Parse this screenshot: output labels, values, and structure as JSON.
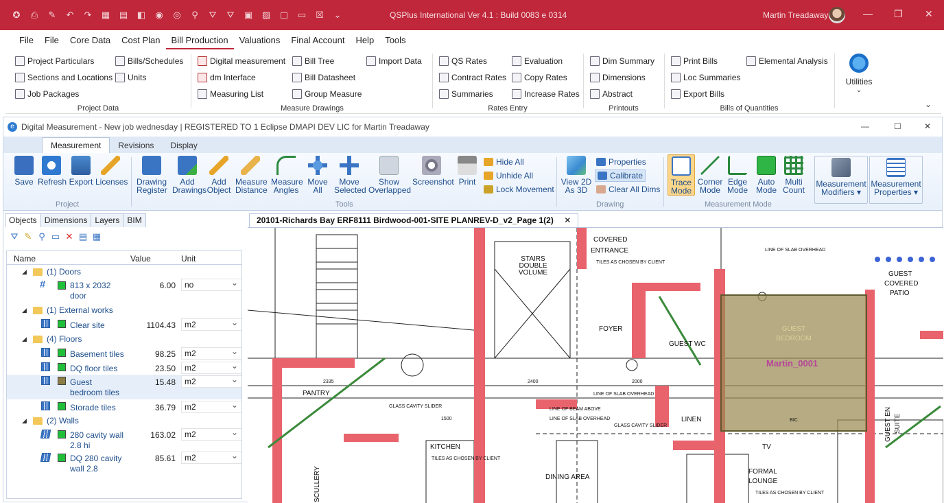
{
  "titlebar": {
    "app_title": "QSPlus International Ver 4.1 : Build 0083 e 0314",
    "user_name": "Martin Treadaway"
  },
  "menu": [
    "File",
    "File",
    "Core Data",
    "Cost Plan",
    "Bill Production",
    "Valuations",
    "Final Account",
    "Help",
    "Tools"
  ],
  "menu_active": "Bill Production",
  "ribbon": {
    "project_data": {
      "label": "Project Data",
      "items": [
        "Project Particulars",
        "Bills/Schedules",
        "Sections and Locations",
        "Units",
        "Job Packages"
      ]
    },
    "measure_drawings": {
      "label": "Measure Drawings",
      "items": [
        "Digital measurement",
        "Bill Tree",
        "Import Data",
        "dm Interface",
        "Bill Datasheet",
        "Measuring List",
        "Group Measure"
      ]
    },
    "rates_entry": {
      "label": "Rates Entry",
      "items": [
        "QS Rates",
        "Evaluation",
        "Contract Rates",
        "Copy Rates",
        "Summaries",
        "Increase Rates"
      ]
    },
    "printouts": {
      "label": "Printouts",
      "items": [
        "Dim Summary",
        "Dimensions",
        "Abstract"
      ]
    },
    "bills_of_quantities": {
      "label": "Bills of Quantities",
      "items": [
        "Print Bills",
        "Elemental Analysis",
        "Loc Summaries",
        "Export Bills"
      ]
    },
    "utilities": "Utilities"
  },
  "dm": {
    "title": "Digital Measurement - New job wednesday | REGISTERED TO 1 Eclipse DMAPI DEV LIC for Martin Treadaway",
    "tabs": [
      "Measurement",
      "Revisions",
      "Display"
    ],
    "groups": {
      "project": "Project",
      "tools": "Tools",
      "drawing": "Drawing",
      "mode": "Measurement Mode"
    },
    "buttons": {
      "save": "Save",
      "refresh": "Refresh",
      "export": "Export",
      "licenses": "Licenses",
      "drawing_register_1": "Drawing",
      "drawing_register_2": "Register",
      "add_drawings_1": "Add",
      "add_drawings_2": "Drawings",
      "add_object_1": "Add",
      "add_object_2": "Object",
      "measure_distance_1": "Measure",
      "measure_distance_2": "Distance",
      "measure_angles_1": "Measure",
      "measure_angles_2": "Angles",
      "move_all_1": "Move",
      "move_all_2": "All",
      "move_selected_1": "Move",
      "move_selected_2": "Selected",
      "show_overlapped_1": "Show",
      "show_overlapped_2": "Overlapped",
      "screenshot": "Screenshot",
      "print": "Print",
      "hide_all": "Hide All",
      "unhide_all": "Unhide All",
      "lock_movement": "Lock Movement",
      "view2d_1": "View 2D",
      "view2d_2": "As 3D",
      "properties": "Properties",
      "calibrate": "Calibrate",
      "clear_all_dims": "Clear All Dims",
      "trace_1": "Trace",
      "trace_2": "Mode",
      "corner_1": "Corner",
      "corner_2": "Mode",
      "edge_1": "Edge",
      "edge_2": "Mode",
      "auto_1": "Auto",
      "auto_2": "Mode",
      "multi_1": "Multi",
      "multi_2": "Count",
      "meas_mod_1": "Measurement",
      "meas_mod_2": "Modifiers ▾",
      "meas_prop_1": "Measurement",
      "meas_prop_2": "Properties ▾"
    },
    "left_tabs": [
      "Objects",
      "Dimensions",
      "Layers",
      "BIM"
    ],
    "grid_headers": {
      "name": "Name",
      "value": "Value",
      "unit": "Unit"
    },
    "tree": {
      "doors": "(1)  Doors",
      "door_name_1": "813 x 2032",
      "door_name_2": "door",
      "door_value": "6.00",
      "door_unit": "no",
      "external": "(1)  External works",
      "clear_site": "Clear site",
      "clear_site_value": "1104.43",
      "clear_site_unit": "m2",
      "floors": "(4)  Floors",
      "basement": "Basement tiles",
      "basement_value": "98.25",
      "basement_unit": "m2",
      "dq_floor": "DQ floor tiles",
      "dq_floor_value": "23.50",
      "dq_floor_unit": "m2",
      "guest_1": "Guest",
      "guest_2": "bedroom tiles",
      "guest_value": "15.48",
      "guest_unit": "m2",
      "storade": "Storade tiles",
      "storade_value": "36.79",
      "storade_unit": "m2",
      "walls": "(2)  Walls",
      "cavity_1": "280 cavity wall",
      "cavity_2": "2.8 hi",
      "cavity_value": "163.02",
      "cavity_unit": "m2",
      "dqcavity_1": "DQ 280 cavity",
      "dqcavity_2": "wall 2.8",
      "dqcavity_value": "85.61",
      "dqcavity_unit": "m2"
    },
    "doc_tab": "20101-Richards Bay ERF8111 Birdwood-001-SITE PLANREV-D_v2_Page 1(2)",
    "drawing_labels": {
      "stairs_1": "STAIRS",
      "stairs_2": "DOUBLE",
      "stairs_3": "VOLUME",
      "covered": "COVERED",
      "entrance": "ENTRANCE",
      "guest_covered_1": "GUEST",
      "guest_covered_2": "COVERED",
      "guest_covered_3": "PATIO",
      "guest_bed_1": "GUEST",
      "guest_bed_2": "BEDROOM",
      "marker": "Martin_0001",
      "foyer": "FOYER",
      "pantry": "PANTRY",
      "kitchen": "KITCHEN",
      "linen": "LINEN",
      "guest_wc": "GUEST WC",
      "dining": "DINING AREA",
      "formal_1": "FORMAL",
      "formal_2": "LOUNGE",
      "scullery": "SCULLERY",
      "suite": "SUITE",
      "guest_en": "GUEST EN",
      "tv": "TV",
      "bic": "BIC",
      "tiles_note": "TILES AS CHOSEN BY CLIENT",
      "slab_overhead": "LINE OF SLAB OVERHEAD",
      "beam_above": "LINE OF BEAM ABOVE",
      "glass_cavity": "GLASS CAVITY SLIDER",
      "dim_2335": "2335",
      "dim_2400": "2400",
      "dim_1500": "1500",
      "dim_2000": "2000"
    }
  },
  "colors": {
    "accent": "#c0273a",
    "ribbon_blue": "#1e4e8c",
    "wall_red": "#e8636c",
    "room_fill": "#9a8a52"
  }
}
